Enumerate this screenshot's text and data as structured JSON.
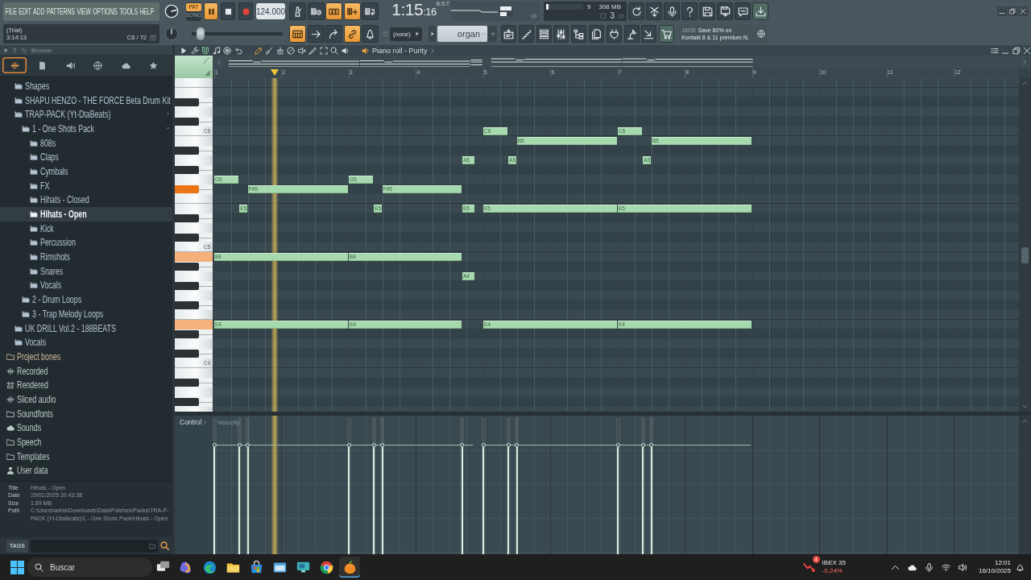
{
  "menu": [
    "FILE",
    "EDIT",
    "ADD",
    "PATTERNS",
    "VIEW",
    "OPTIONS",
    "TOOLS",
    "HELP"
  ],
  "hint_bar": {
    "title": "(Trial)",
    "text": "3:14:13",
    "note": "C6 / 72"
  },
  "transport": {
    "modes": [
      {
        "label": "PAT",
        "selected": true
      },
      {
        "label": "SONG",
        "selected": false
      }
    ],
    "playing": true,
    "tempo": "124.000"
  },
  "toggles_top": [
    {
      "on": false
    },
    {
      "on": false
    },
    {
      "on": true
    },
    {
      "on": true
    },
    {
      "on": false
    }
  ],
  "clock": {
    "time": "1:15",
    "ticks": ":16",
    "format": "B:S:T"
  },
  "output_meters": [
    {
      "level": 0.85
    },
    {
      "level": 0.5
    }
  ],
  "performance": {
    "cpu": {
      "level": 0.07,
      "reading": "9"
    },
    "memory": "308 MB",
    "voices": "3"
  },
  "pitch_slider": {
    "level": 0.1
  },
  "toggles_bottom": [
    {
      "on": true
    },
    {
      "on": false
    },
    {
      "on": false
    },
    {
      "on": true
    },
    {
      "on": false
    }
  ],
  "dropdown": {
    "value": "(none)"
  },
  "pattern_selector": {
    "value": "organ"
  },
  "news": {
    "date": "18/09",
    "lines": [
      "Save 80% on",
      "Kontakt 8 & 11 premium N."
    ]
  },
  "browser": {
    "title": "Browser",
    "tabs": [
      {
        "selected": true
      },
      {
        "selected": false
      },
      {
        "selected": false
      },
      {
        "selected": false
      },
      {
        "selected": false
      },
      {
        "selected": false
      }
    ],
    "tree": [
      {
        "children": [
          {
            "label": "Shapes",
            "kind": "pack",
            "selected": false,
            "expanded": false
          },
          {
            "label": "SHAPU HENZO - THE FORCE Beta Drum Kit",
            "kind": "pack",
            "selected": false,
            "expanded": false
          },
          {
            "label": "TRAP-PACK (Yt-DtaBeats)",
            "kind": "pack",
            "selected": false,
            "expanded": true,
            "children": [
              {
                "label": "1 - One Shots Pack",
                "kind": "pack",
                "selected": false,
                "expanded": true,
                "children": [
                  {
                    "label": "808s",
                    "kind": "pack",
                    "selected": false,
                    "expanded": false
                  },
                  {
                    "label": "Claps",
                    "kind": "pack",
                    "selected": false,
                    "expanded": false
                  },
                  {
                    "label": "Cymbals",
                    "kind": "pack",
                    "selected": false,
                    "expanded": false
                  },
                  {
                    "label": "FX",
                    "kind": "pack",
                    "selected": false,
                    "expanded": false
                  },
                  {
                    "label": "Hihats - Closed",
                    "kind": "pack",
                    "selected": false,
                    "expanded": false
                  },
                  {
                    "label": "Hihats - Open",
                    "kind": "pack",
                    "selected": true,
                    "expanded": false
                  },
                  {
                    "label": "Kick",
                    "kind": "pack",
                    "selected": false,
                    "expanded": false
                  },
                  {
                    "label": "Percussion",
                    "kind": "pack",
                    "selected": false,
                    "expanded": false
                  },
                  {
                    "label": "Rimshots",
                    "kind": "pack",
                    "selected": false,
                    "expanded": false
                  },
                  {
                    "label": "Snares",
                    "kind": "pack",
                    "selected": false,
                    "expanded": false
                  },
                  {
                    "label": "Vocals",
                    "kind": "pack",
                    "selected": false,
                    "expanded": false
                  }
                ]
              },
              {
                "label": "2 - Drum Loops",
                "kind": "pack",
                "selected": false,
                "expanded": false
              },
              {
                "label": "3 - Trap Melody Loops",
                "kind": "pack",
                "selected": false,
                "expanded": false
              }
            ]
          },
          {
            "label": "UK DRILL Vol.2 - 188BEATS",
            "kind": "pack",
            "selected": false,
            "expanded": false
          },
          {
            "label": "Vocals",
            "kind": "pack",
            "selected": false,
            "expanded": false
          }
        ]
      },
      {
        "label": "Project bones",
        "kind": "project",
        "selected": false,
        "expanded": false
      },
      {
        "label": "Recorded",
        "kind": "audio",
        "selected": false,
        "expanded": false
      },
      {
        "label": "Rendered",
        "kind": "rendered",
        "selected": false,
        "expanded": false
      },
      {
        "label": "Sliced audio",
        "kind": "audio",
        "selected": false,
        "expanded": false
      },
      {
        "label": "Soundfonts",
        "kind": "folder",
        "selected": false,
        "expanded": false
      },
      {
        "label": "Sounds",
        "kind": "cloud",
        "selected": false,
        "expanded": false
      },
      {
        "label": "Speech",
        "kind": "folder",
        "selected": false,
        "expanded": false
      },
      {
        "label": "Templates",
        "kind": "folder",
        "selected": false,
        "expanded": false
      },
      {
        "label": "User data",
        "kind": "user",
        "selected": false,
        "expanded": false
      }
    ],
    "info": [
      {
        "label": "Title",
        "value": "Hihats - Open"
      },
      {
        "label": "Date",
        "value": "29/01/2025 20:43:38"
      },
      {
        "label": "Size",
        "value": "1.89 MB"
      },
      {
        "label": "Path",
        "value": "C:\\Users\\adria\\Downloads\\Data\\Patches\\Packs\\TRA-P-PACK (Yt-DtaBeats)\\1 - One Shots Pack\\Hihats - Open"
      }
    ],
    "tags_label": "TAGS"
  },
  "piano_roll": {
    "title": "Piano roll - Purity",
    "snap": {
      "on": true
    },
    "tools": [
      {
        "selected": true
      },
      {
        "selected": false
      },
      {
        "selected": false
      },
      {
        "selected": false
      },
      {
        "selected": false
      },
      {
        "selected": false
      },
      {
        "selected": false
      },
      {
        "selected": false
      },
      {
        "selected": false
      }
    ],
    "ruler": [
      "1",
      "2",
      "3",
      "4",
      "5",
      "6",
      "7",
      "8",
      "9",
      "10",
      "11",
      "12"
    ],
    "keyboard": [
      {
        "kind": "white",
        "pressed": false
      },
      {
        "kind": "white",
        "pressed": false
      },
      {
        "kind": "black",
        "pressed": false
      },
      {
        "kind": "white",
        "pressed": false
      },
      {
        "kind": "black",
        "pressed": false
      },
      {
        "kind": "white",
        "pressed": false,
        "label": "C6"
      },
      {
        "kind": "white",
        "pressed": false
      },
      {
        "kind": "black",
        "pressed": false
      },
      {
        "kind": "white",
        "pressed": false
      },
      {
        "kind": "black",
        "pressed": false
      },
      {
        "kind": "white",
        "pressed": false
      },
      {
        "kind": "black",
        "pressed": true
      },
      {
        "kind": "white",
        "pressed": false
      },
      {
        "kind": "white",
        "pressed": false
      },
      {
        "kind": "black",
        "pressed": false
      },
      {
        "kind": "white",
        "pressed": false
      },
      {
        "kind": "black",
        "pressed": false
      },
      {
        "kind": "white",
        "pressed": false,
        "label": "C5"
      },
      {
        "kind": "white",
        "pressed": true
      },
      {
        "kind": "black",
        "pressed": false
      },
      {
        "kind": "white",
        "pressed": false
      },
      {
        "kind": "black",
        "pressed": false
      },
      {
        "kind": "white",
        "pressed": false
      },
      {
        "kind": "black",
        "pressed": false
      },
      {
        "kind": "white",
        "pressed": false
      },
      {
        "kind": "white",
        "pressed": true
      },
      {
        "kind": "black",
        "pressed": false
      },
      {
        "kind": "white",
        "pressed": false
      },
      {
        "kind": "black",
        "pressed": false
      },
      {
        "kind": "white",
        "pressed": false,
        "label": "C4"
      },
      {
        "kind": "white",
        "pressed": false
      },
      {
        "kind": "black",
        "pressed": false
      },
      {
        "kind": "white",
        "pressed": false
      },
      {
        "kind": "black",
        "pressed": false
      },
      {
        "kind": "white",
        "pressed": false
      }
    ],
    "notes": [
      {
        "label": "G5"
      },
      {
        "label": "B4"
      },
      {
        "label": "E4"
      },
      {
        "label": "E5"
      },
      {
        "label": "F#5"
      },
      {
        "label": "G5"
      },
      {
        "label": "B4"
      },
      {
        "label": "E4"
      },
      {
        "label": "E5"
      },
      {
        "label": "F#5"
      },
      {
        "label": "A5"
      },
      {
        "label": "E5"
      },
      {
        "label": "A4"
      },
      {
        "label": "C6"
      },
      {
        "label": "E5"
      },
      {
        "label": "E4"
      },
      {
        "label": "A5"
      },
      {
        "label": "B5"
      },
      {
        "label": "C6"
      },
      {
        "label": "E5"
      },
      {
        "label": "E4"
      },
      {
        "label": "A5"
      },
      {
        "label": "B5"
      }
    ],
    "control": {
      "label": "Control",
      "lane": "Velocity"
    },
    "velocity": [
      {
        "level": 0.78
      },
      {
        "level": 0.78
      },
      {
        "level": 0.78
      },
      {
        "level": 0.78
      },
      {
        "level": 0.78
      },
      {
        "level": 0.78
      },
      {
        "level": 0.78
      },
      {
        "level": 0.78
      },
      {
        "level": 0.78
      },
      {
        "level": 0.78
      },
      {
        "level": 0.78
      },
      {
        "level": 0.78
      },
      {
        "level": 0.78
      }
    ]
  },
  "taskbar": {
    "search": {
      "placeholder": "Buscar"
    },
    "apps": [
      {
        "active": false
      },
      {
        "active": false
      },
      {
        "active": false
      },
      {
        "active": false
      },
      {
        "active": false
      },
      {
        "active": false
      },
      {
        "active": false
      },
      {
        "active": false
      },
      {
        "active": true
      }
    ],
    "widget": {
      "badge": "4",
      "name": "IBEX 35",
      "change": "-0,24%"
    },
    "clock": {
      "time": "12:01",
      "date": "16/10/2025"
    }
  }
}
